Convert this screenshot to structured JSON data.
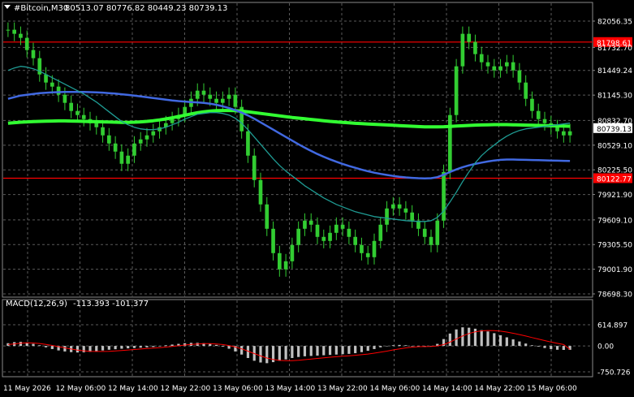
{
  "window": {
    "symbol_line": "#Bitcoin,M30",
    "ohlc": "80513.07 80776.82 80449.23 80739.13",
    "indicator_label": "MACD(12,26,9)",
    "indicator_values": "-113.393 -101.377"
  },
  "colors": {
    "background": "#000000",
    "grid": "#5a5a5a",
    "candle": "#32cd32",
    "ma_fast": "#1f9c94",
    "ma_mid": "#4169e1",
    "ma_slow": "#32ff32",
    "level_line": "#ff0000",
    "macd_hist": "#c0c0c0",
    "macd_signal": "#ff0000",
    "text": "#ffffff"
  },
  "chart_data": [
    {
      "type": "line",
      "name": "price",
      "y_ticks": [
        "82056.35",
        "81732.70",
        "81449.24",
        "81145.30",
        "80832.70",
        "80529.10",
        "80225.50",
        "79921.90",
        "79609.10",
        "79305.50",
        "79001.90",
        "78698.30"
      ],
      "ylim": [
        78698.3,
        82056.35
      ],
      "current_price_label": "80739.13",
      "levels": [
        {
          "label": "81798.61",
          "value": 81798.61
        },
        {
          "label": "80122.77",
          "value": 80122.77
        }
      ],
      "x_labels": [
        "11 May 2026",
        "12 May 06:00",
        "12 May 14:00",
        "12 May 22:00",
        "13 May 06:00",
        "13 May 14:00",
        "13 May 22:00",
        "14 May 06:00",
        "14 May 14:00",
        "14 May 22:00",
        "15 May 06:00"
      ],
      "close": [
        81950,
        81900,
        81850,
        81700,
        81600,
        81400,
        81300,
        81250,
        81150,
        81050,
        80950,
        80900,
        80850,
        80800,
        80750,
        80650,
        80550,
        80450,
        80300,
        80400,
        80550,
        80600,
        80650,
        80700,
        80750,
        80800,
        80850,
        80900,
        81000,
        81100,
        81200,
        81150,
        81100,
        81050,
        81100,
        81150,
        81000,
        80700,
        80400,
        80100,
        79800,
        79500,
        79200,
        79000,
        79100,
        79300,
        79500,
        79600,
        79550,
        79400,
        79350,
        79450,
        79550,
        79500,
        79400,
        79300,
        79200,
        79150,
        79350,
        79550,
        79750,
        79800,
        79750,
        79700,
        79600,
        79500,
        79400,
        79300,
        79600,
        80200,
        80900,
        81500,
        81900,
        81800,
        81650,
        81550,
        81500,
        81450,
        81500,
        81550,
        81450,
        81300,
        81100,
        80950,
        80850,
        80800,
        80750,
        80700,
        80650,
        80700
      ],
      "ma_fast": [
        81450,
        81480,
        81500,
        81490,
        81470,
        81440,
        81400,
        81360,
        81320,
        81280,
        81240,
        81200,
        81160,
        81110,
        81060,
        81000,
        80940,
        80880,
        80820,
        80780,
        80750,
        80730,
        80720,
        80720,
        80730,
        80750,
        80780,
        80810,
        80850,
        80880,
        80910,
        80920,
        80930,
        80930,
        80920,
        80900,
        80860,
        80800,
        80720,
        80630,
        80540,
        80450,
        80360,
        80280,
        80210,
        80150,
        80090,
        80030,
        79980,
        79930,
        79880,
        79840,
        79800,
        79770,
        79740,
        79710,
        79690,
        79670,
        79650,
        79640,
        79630,
        79620,
        79610,
        79600,
        79595,
        79590,
        79590,
        79600,
        79640,
        79720,
        79830,
        79950,
        80080,
        80200,
        80310,
        80400,
        80470,
        80530,
        80590,
        80640,
        80680,
        80710,
        80730,
        80740,
        80750,
        80760,
        80770,
        80780,
        80790,
        80800
      ],
      "ma_mid": [
        81100,
        81120,
        81140,
        81150,
        81160,
        81170,
        81175,
        81180,
        81182,
        81184,
        81185,
        81185,
        81184,
        81182,
        81180,
        81176,
        81170,
        81164,
        81156,
        81148,
        81140,
        81130,
        81120,
        81110,
        81100,
        81090,
        81080,
        81072,
        81066,
        81060,
        81056,
        81050,
        81040,
        81026,
        81008,
        80986,
        80960,
        80930,
        80895,
        80855,
        80810,
        80765,
        80720,
        80675,
        80630,
        80585,
        80540,
        80498,
        80458,
        80420,
        80386,
        80354,
        80325,
        80298,
        80273,
        80250,
        80228,
        80208,
        80190,
        80175,
        80162,
        80150,
        80140,
        80132,
        80126,
        80122,
        80120,
        80122,
        80135,
        80165,
        80198,
        80230,
        80258,
        80280,
        80298,
        80314,
        80328,
        80340,
        80348,
        80352,
        80352,
        80350,
        80348,
        80346,
        80344,
        80342,
        80340,
        80338,
        80336,
        80334
      ],
      "ma_slow": [
        80800,
        80806,
        80812,
        80816,
        80820,
        80822,
        80824,
        80826,
        80828,
        80828,
        80826,
        80824,
        80822,
        80820,
        80818,
        80816,
        80814,
        80812,
        80810,
        80810,
        80812,
        80816,
        80822,
        80830,
        80840,
        80852,
        80866,
        80882,
        80898,
        80914,
        80928,
        80940,
        80948,
        80954,
        80956,
        80956,
        80954,
        80948,
        80940,
        80930,
        80920,
        80910,
        80900,
        80890,
        80880,
        80870,
        80862,
        80854,
        80846,
        80838,
        80830,
        80822,
        80816,
        80810,
        80804,
        80798,
        80794,
        80790,
        80786,
        80782,
        80778,
        80774,
        80770,
        80766,
        80762,
        80758,
        80755,
        80754,
        80754,
        80756,
        80760,
        80764,
        80768,
        80772,
        80776,
        80778,
        80780,
        80782,
        80782,
        80782,
        80780,
        80778,
        80776,
        80774,
        80772,
        80770,
        80768,
        80766,
        80764,
        80762
      ]
    },
    {
      "type": "bar",
      "name": "MACD(12,26,9)",
      "y_ticks": [
        "614.897",
        "0.00",
        "-750.726"
      ],
      "ylim": [
        -750.726,
        614.897
      ],
      "histogram": [
        80,
        110,
        120,
        100,
        60,
        20,
        -40,
        -90,
        -130,
        -160,
        -180,
        -190,
        -185,
        -170,
        -150,
        -130,
        -110,
        -95,
        -80,
        -70,
        -60,
        -50,
        -40,
        -30,
        -10,
        20,
        40,
        60,
        80,
        90,
        90,
        80,
        60,
        30,
        -20,
        -80,
        -160,
        -250,
        -350,
        -430,
        -480,
        -500,
        -470,
        -430,
        -390,
        -350,
        -320,
        -300,
        -290,
        -280,
        -270,
        -260,
        -250,
        -240,
        -230,
        -210,
        -180,
        -140,
        -90,
        -40,
        0,
        20,
        30,
        20,
        0,
        -20,
        -30,
        -10,
        60,
        200,
        360,
        480,
        540,
        530,
        500,
        460,
        420,
        370,
        310,
        250,
        190,
        130,
        70,
        20,
        -20,
        -60,
        -90,
        -110,
        -115,
        -113
      ],
      "signal": [
        40,
        60,
        80,
        90,
        85,
        70,
        45,
        15,
        -20,
        -55,
        -90,
        -120,
        -140,
        -155,
        -160,
        -160,
        -155,
        -145,
        -132,
        -118,
        -104,
        -90,
        -76,
        -62,
        -48,
        -32,
        -14,
        6,
        26,
        44,
        58,
        66,
        66,
        58,
        40,
        12,
        -30,
        -84,
        -150,
        -222,
        -290,
        -350,
        -392,
        -418,
        -428,
        -426,
        -414,
        -398,
        -380,
        -362,
        -344,
        -328,
        -312,
        -298,
        -284,
        -270,
        -254,
        -234,
        -210,
        -182,
        -150,
        -116,
        -84,
        -56,
        -34,
        -22,
        -18,
        -16,
        0,
        40,
        110,
        200,
        290,
        360,
        410,
        438,
        448,
        444,
        428,
        402,
        368,
        330,
        288,
        244,
        200,
        156,
        114,
        76,
        40,
        -101
      ]
    }
  ]
}
